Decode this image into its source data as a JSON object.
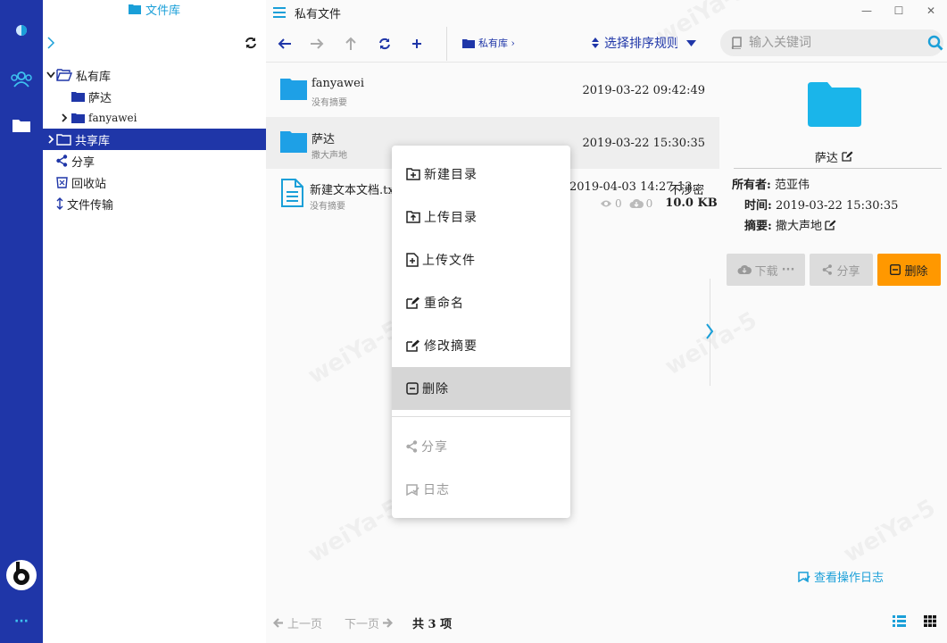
{
  "window": {
    "title": "私有文件",
    "minimize": "—",
    "maximize": "☐",
    "close": "✕"
  },
  "sidebar": {
    "title": "文件库",
    "tree": [
      {
        "label": "私有库"
      },
      {
        "label": "萨达"
      },
      {
        "label": "fanyawei"
      },
      {
        "label": "共享库"
      },
      {
        "label": "分享"
      },
      {
        "label": "回收站"
      },
      {
        "label": "文件传输"
      }
    ]
  },
  "rail": {
    "more": "···"
  },
  "toolbar": {
    "breadcrumb": "私有库 ›",
    "sort_placeholder": "选择排序规则",
    "search_placeholder": "输入关键词"
  },
  "files": [
    {
      "name": "fanyawei",
      "summary": "没有摘要",
      "date": "2019-03-22 09:42:49"
    },
    {
      "name": "萨达",
      "summary": "撒大声地",
      "date": "2019-03-22 15:30:35"
    },
    {
      "name": "新建文本文档.txt",
      "summary": "没有摘要",
      "date": "2019-04-03 14:27:13",
      "security": "不涉密",
      "views": "0",
      "downloads": "0",
      "size": "10.0 KB"
    }
  ],
  "context_menu": {
    "items": [
      {
        "label": "新建目录"
      },
      {
        "label": "上传目录"
      },
      {
        "label": "上传文件"
      },
      {
        "label": "重命名"
      },
      {
        "label": "修改摘要"
      },
      {
        "label": "删除"
      },
      {
        "label": "分享"
      },
      {
        "label": "日志"
      }
    ]
  },
  "detail": {
    "name": "萨达",
    "owner_label": "所有者:",
    "owner": "范亚伟",
    "time_label": "时间:",
    "time": "2019-03-22 15:30:35",
    "summary_label": "摘要:",
    "summary": "撒大声地",
    "download_label": "下载",
    "share_label": "分享",
    "delete_label": "删除",
    "log_label": "查看操作日志"
  },
  "footer": {
    "prev": "上一页",
    "next": "下一页",
    "total": "共 3 项"
  },
  "watermark": "weiYa-5",
  "colors": {
    "primary": "#1f36a8",
    "accent": "#1a9fd8",
    "folder": "#1ea0e6",
    "delete": "#ff9800"
  }
}
